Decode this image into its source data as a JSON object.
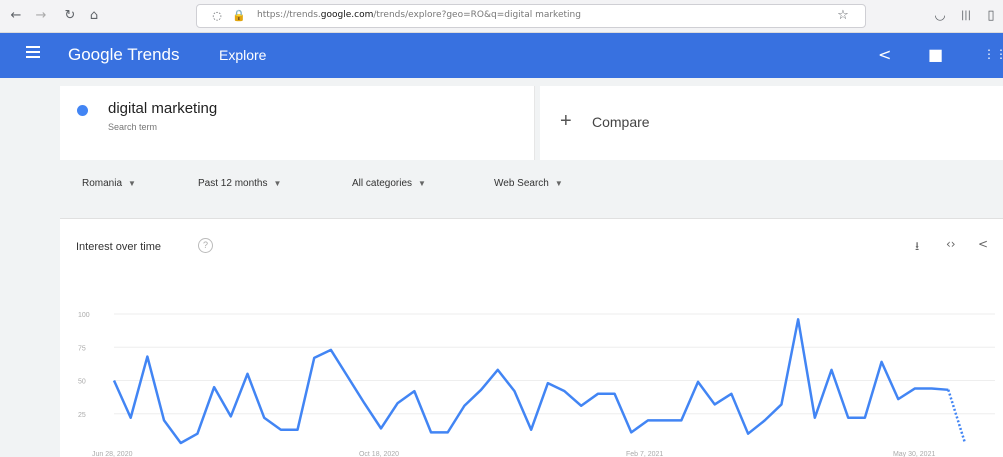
{
  "browser": {
    "url_prefix": "https://trends.",
    "url_domain": "google.com",
    "url_rest": "/trends/explore?geo=RO&q=digital marketing"
  },
  "header": {
    "brand": "Google Trends",
    "section": "Explore"
  },
  "search": {
    "term": "digital marketing",
    "term_type": "Search term",
    "term_color": "#4285f4",
    "compare_label": "Compare"
  },
  "filters": {
    "region": "Romania",
    "period": "Past 12 months",
    "category": "All categories",
    "property": "Web Search"
  },
  "chart": {
    "title": "Interest over time"
  },
  "chart_data": {
    "type": "line",
    "title": "Interest over time",
    "ylim": [
      0,
      100
    ],
    "y_ticks": [
      100,
      75,
      50,
      25
    ],
    "x_tick_labels": [
      "Jun 28, 2020",
      "Oct 18, 2020",
      "Feb 7, 2021",
      "May 30, 2021"
    ],
    "x_tick_index": [
      0,
      16,
      32,
      48
    ],
    "series": [
      {
        "color": "#4285f4",
        "values": [
          50,
          22,
          68,
          20,
          3,
          10,
          45,
          23,
          55,
          22,
          13,
          13,
          67,
          73,
          53,
          33,
          14,
          33,
          42,
          11,
          11,
          31,
          43,
          58,
          42,
          13,
          48,
          42,
          31,
          40,
          40,
          11,
          20,
          20,
          20,
          49,
          32,
          40,
          10,
          20,
          32,
          96,
          22,
          58,
          22,
          22,
          64,
          36,
          44,
          44,
          43,
          3
        ],
        "partial_from_index": 50
      }
    ],
    "grid": true
  }
}
